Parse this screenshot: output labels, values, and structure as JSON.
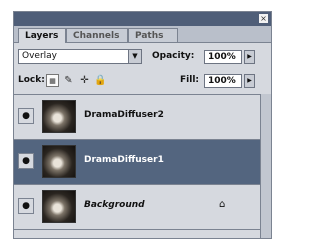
{
  "tabs": {
    "layers": "Layers",
    "channels": "Channels",
    "paths": "Paths"
  },
  "controls": {
    "blend_mode": "Overlay",
    "opacity_label": "Opacity:",
    "opacity_value": "100%",
    "lock_label": "Lock:",
    "fill_label": "Fill:",
    "fill_value": "100%"
  },
  "icons": {
    "close": "×",
    "dropdown": "▼",
    "stepper": "▶",
    "eye": "●",
    "lock_transparent": "▦",
    "lock_image": "✎",
    "lock_position": "✛",
    "lock_all": "🔒",
    "layer_lock": "⌂"
  },
  "layers": [
    {
      "name": "DramaDiffuser2",
      "selected": false
    },
    {
      "name": "DramaDiffuser1",
      "selected": true
    },
    {
      "name": "Background",
      "selected": false,
      "locked": true
    }
  ],
  "colors": {
    "selected_row": "#53657f",
    "panel_bg": "#d6d9df",
    "title_bar": "#4f5e78"
  }
}
